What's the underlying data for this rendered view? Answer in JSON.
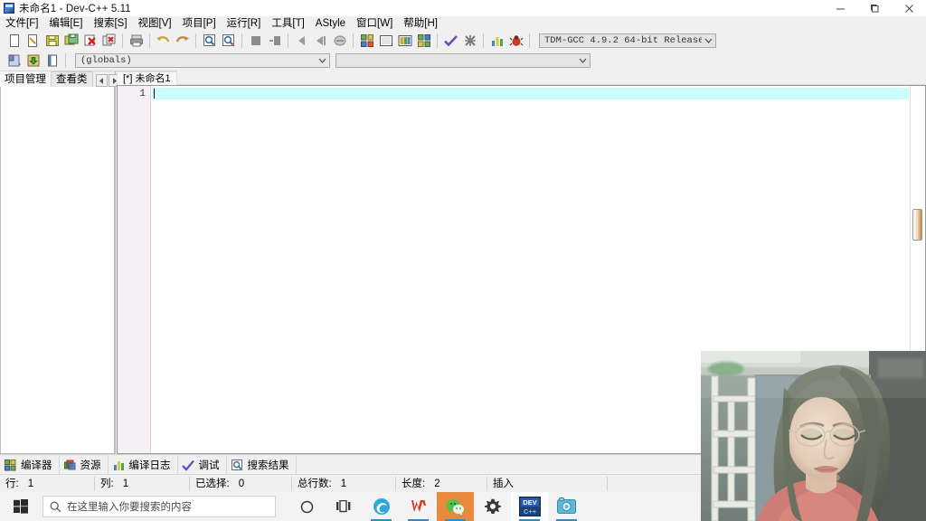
{
  "window": {
    "title": "未命名1 - Dev-C++ 5.11",
    "icon": "devcpp-icon",
    "minimize": "minimize-button",
    "maximize": "maximize-button",
    "close": "close-button"
  },
  "menubar": {
    "items": [
      {
        "label": "文件[F]",
        "name": "menu-file"
      },
      {
        "label": "编辑[E]",
        "name": "menu-edit"
      },
      {
        "label": "搜索[S]",
        "name": "menu-search"
      },
      {
        "label": "视图[V]",
        "name": "menu-view"
      },
      {
        "label": "项目[P]",
        "name": "menu-project"
      },
      {
        "label": "运行[R]",
        "name": "menu-run"
      },
      {
        "label": "工具[T]",
        "name": "menu-tools"
      },
      {
        "label": "AStyle",
        "name": "menu-astyle"
      },
      {
        "label": "窗口[W]",
        "name": "menu-window"
      },
      {
        "label": "帮助[H]",
        "name": "menu-help"
      }
    ]
  },
  "toolbar": {
    "compiler_combo": {
      "value": "TDM-GCC 4.9.2 64-bit Release",
      "name": "compiler-select"
    },
    "scope_combo": {
      "value": "(globals)",
      "name": "scope-select"
    },
    "member_combo": {
      "value": "",
      "name": "member-select"
    }
  },
  "left_panel": {
    "tabs": [
      {
        "label": "项目管理",
        "name": "tab-project-manager",
        "active": true
      },
      {
        "label": "查看类",
        "name": "tab-class-browser",
        "active": false
      }
    ],
    "nav_prev": "scroll-left-button",
    "nav_next": "scroll-right-button"
  },
  "editor": {
    "file_tab": "[*] 未命名1",
    "line_numbers": [
      "1"
    ],
    "lines": [
      ""
    ],
    "current_line": 1
  },
  "bottom_tools": [
    {
      "label": "编译器",
      "name": "panel-compiler",
      "icon": "grid-icon"
    },
    {
      "label": "资源",
      "name": "panel-resources",
      "icon": "layers-icon"
    },
    {
      "label": "编译日志",
      "name": "panel-compile-log",
      "icon": "bars-icon"
    },
    {
      "label": "调试",
      "name": "panel-debug",
      "icon": "check-icon"
    },
    {
      "label": "搜索结果",
      "name": "panel-search-results",
      "icon": "magnifier-icon"
    }
  ],
  "statusbar": {
    "cells": [
      {
        "key": "行:",
        "value": "1",
        "name": "status-row"
      },
      {
        "key": "列:",
        "value": "1",
        "name": "status-col"
      },
      {
        "key": "已选择:",
        "value": "0",
        "name": "status-selected"
      },
      {
        "key": "总行数:",
        "value": "1",
        "name": "status-total-lines"
      },
      {
        "key": "长度:",
        "value": "2",
        "name": "status-length"
      },
      {
        "key": "插入",
        "value": "",
        "name": "status-insert-mode"
      }
    ]
  },
  "taskbar": {
    "start": "windows-start-button",
    "search_placeholder": "在这里输入你要搜索的内容",
    "search_icon": "search-icon",
    "items": [
      {
        "name": "cortana-icon",
        "label": "Cortana"
      },
      {
        "name": "task-view-icon",
        "label": "任务视图"
      },
      {
        "name": "edge-icon",
        "label": "Microsoft Edge"
      },
      {
        "name": "wps-icon",
        "label": "WPS Office"
      },
      {
        "name": "wechat-icon",
        "label": "微信"
      },
      {
        "name": "settings-gear-icon",
        "label": "设置"
      },
      {
        "name": "devcpp-taskbar-icon",
        "label": "Dev-C++"
      },
      {
        "name": "screen-recorder-icon",
        "label": "录屏"
      }
    ]
  },
  "webcam": {
    "name": "webcam-overlay",
    "description": "摄像头画面"
  },
  "colors": {
    "current_line": "#ccfdfd",
    "taskbar_active": "#e88a3c",
    "window_bg": "#f0f0f0",
    "editor_bg": "#ffffff"
  }
}
